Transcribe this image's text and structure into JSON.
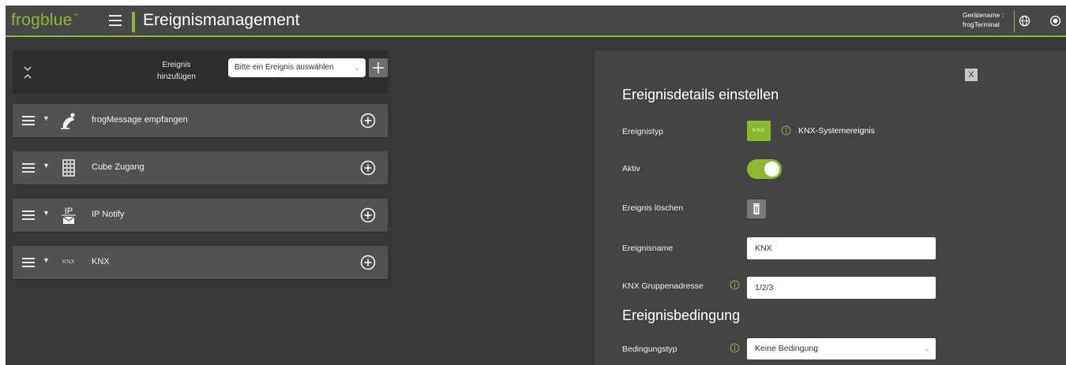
{
  "header": {
    "logo": "frogblue",
    "logo_mark": "™",
    "title": "Ereignismanagement",
    "device_label": "Gerätename :",
    "device_name": "frogTerminal"
  },
  "left_panel": {
    "add_label_line1": "Ereignis",
    "add_label_line2": "hinzufügen",
    "event_select_value": "Bitte ein Ereignis auswählen",
    "events": [
      {
        "label": "frogMessage empfangen",
        "icon": "frog-message-icon"
      },
      {
        "label": "Cube Zugang",
        "icon": "keypad-icon"
      },
      {
        "label": "IP Notify",
        "icon": "ip-notify-icon"
      },
      {
        "label": "KNX",
        "icon": "knx-icon",
        "icon_text": "KNX"
      }
    ]
  },
  "detail": {
    "title": "Ereignisdetails einstellen",
    "type_label": "Ereignistyp",
    "type_badge": "KNX",
    "type_value": "KNX-Systemereignis",
    "active_label": "Aktiv",
    "active_on": true,
    "delete_label": "Ereignis löschen",
    "name_label": "Ereignisname",
    "name_value": "KNX",
    "group_address_label": "KNX Gruppenadresse",
    "group_address_value": "1/2/3",
    "condition_title": "Ereignisbedingung",
    "condition_type_label": "Bedingungstyp",
    "condition_type_value": "Keine Bedingung",
    "close_label": "X"
  },
  "colors": {
    "accent": "#8ab82e",
    "background": "#373737",
    "header": "#474747",
    "panel": "#444444",
    "card": "#525252"
  }
}
